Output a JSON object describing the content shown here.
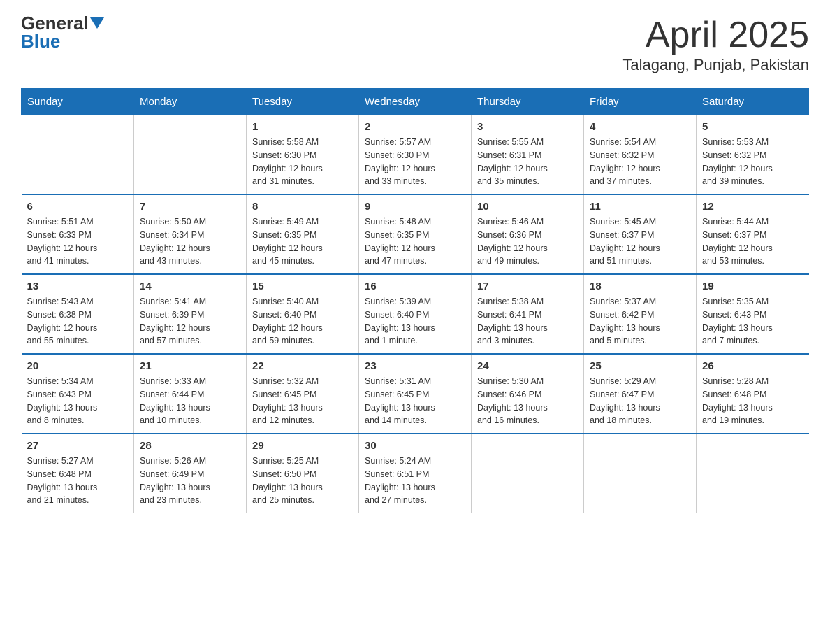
{
  "header": {
    "logo_general": "General",
    "logo_blue": "Blue",
    "title": "April 2025",
    "subtitle": "Talagang, Punjab, Pakistan"
  },
  "days_of_week": [
    "Sunday",
    "Monday",
    "Tuesday",
    "Wednesday",
    "Thursday",
    "Friday",
    "Saturday"
  ],
  "weeks": [
    [
      {
        "day": "",
        "info": ""
      },
      {
        "day": "",
        "info": ""
      },
      {
        "day": "1",
        "info": "Sunrise: 5:58 AM\nSunset: 6:30 PM\nDaylight: 12 hours\nand 31 minutes."
      },
      {
        "day": "2",
        "info": "Sunrise: 5:57 AM\nSunset: 6:30 PM\nDaylight: 12 hours\nand 33 minutes."
      },
      {
        "day": "3",
        "info": "Sunrise: 5:55 AM\nSunset: 6:31 PM\nDaylight: 12 hours\nand 35 minutes."
      },
      {
        "day": "4",
        "info": "Sunrise: 5:54 AM\nSunset: 6:32 PM\nDaylight: 12 hours\nand 37 minutes."
      },
      {
        "day": "5",
        "info": "Sunrise: 5:53 AM\nSunset: 6:32 PM\nDaylight: 12 hours\nand 39 minutes."
      }
    ],
    [
      {
        "day": "6",
        "info": "Sunrise: 5:51 AM\nSunset: 6:33 PM\nDaylight: 12 hours\nand 41 minutes."
      },
      {
        "day": "7",
        "info": "Sunrise: 5:50 AM\nSunset: 6:34 PM\nDaylight: 12 hours\nand 43 minutes."
      },
      {
        "day": "8",
        "info": "Sunrise: 5:49 AM\nSunset: 6:35 PM\nDaylight: 12 hours\nand 45 minutes."
      },
      {
        "day": "9",
        "info": "Sunrise: 5:48 AM\nSunset: 6:35 PM\nDaylight: 12 hours\nand 47 minutes."
      },
      {
        "day": "10",
        "info": "Sunrise: 5:46 AM\nSunset: 6:36 PM\nDaylight: 12 hours\nand 49 minutes."
      },
      {
        "day": "11",
        "info": "Sunrise: 5:45 AM\nSunset: 6:37 PM\nDaylight: 12 hours\nand 51 minutes."
      },
      {
        "day": "12",
        "info": "Sunrise: 5:44 AM\nSunset: 6:37 PM\nDaylight: 12 hours\nand 53 minutes."
      }
    ],
    [
      {
        "day": "13",
        "info": "Sunrise: 5:43 AM\nSunset: 6:38 PM\nDaylight: 12 hours\nand 55 minutes."
      },
      {
        "day": "14",
        "info": "Sunrise: 5:41 AM\nSunset: 6:39 PM\nDaylight: 12 hours\nand 57 minutes."
      },
      {
        "day": "15",
        "info": "Sunrise: 5:40 AM\nSunset: 6:40 PM\nDaylight: 12 hours\nand 59 minutes."
      },
      {
        "day": "16",
        "info": "Sunrise: 5:39 AM\nSunset: 6:40 PM\nDaylight: 13 hours\nand 1 minute."
      },
      {
        "day": "17",
        "info": "Sunrise: 5:38 AM\nSunset: 6:41 PM\nDaylight: 13 hours\nand 3 minutes."
      },
      {
        "day": "18",
        "info": "Sunrise: 5:37 AM\nSunset: 6:42 PM\nDaylight: 13 hours\nand 5 minutes."
      },
      {
        "day": "19",
        "info": "Sunrise: 5:35 AM\nSunset: 6:43 PM\nDaylight: 13 hours\nand 7 minutes."
      }
    ],
    [
      {
        "day": "20",
        "info": "Sunrise: 5:34 AM\nSunset: 6:43 PM\nDaylight: 13 hours\nand 8 minutes."
      },
      {
        "day": "21",
        "info": "Sunrise: 5:33 AM\nSunset: 6:44 PM\nDaylight: 13 hours\nand 10 minutes."
      },
      {
        "day": "22",
        "info": "Sunrise: 5:32 AM\nSunset: 6:45 PM\nDaylight: 13 hours\nand 12 minutes."
      },
      {
        "day": "23",
        "info": "Sunrise: 5:31 AM\nSunset: 6:45 PM\nDaylight: 13 hours\nand 14 minutes."
      },
      {
        "day": "24",
        "info": "Sunrise: 5:30 AM\nSunset: 6:46 PM\nDaylight: 13 hours\nand 16 minutes."
      },
      {
        "day": "25",
        "info": "Sunrise: 5:29 AM\nSunset: 6:47 PM\nDaylight: 13 hours\nand 18 minutes."
      },
      {
        "day": "26",
        "info": "Sunrise: 5:28 AM\nSunset: 6:48 PM\nDaylight: 13 hours\nand 19 minutes."
      }
    ],
    [
      {
        "day": "27",
        "info": "Sunrise: 5:27 AM\nSunset: 6:48 PM\nDaylight: 13 hours\nand 21 minutes."
      },
      {
        "day": "28",
        "info": "Sunrise: 5:26 AM\nSunset: 6:49 PM\nDaylight: 13 hours\nand 23 minutes."
      },
      {
        "day": "29",
        "info": "Sunrise: 5:25 AM\nSunset: 6:50 PM\nDaylight: 13 hours\nand 25 minutes."
      },
      {
        "day": "30",
        "info": "Sunrise: 5:24 AM\nSunset: 6:51 PM\nDaylight: 13 hours\nand 27 minutes."
      },
      {
        "day": "",
        "info": ""
      },
      {
        "day": "",
        "info": ""
      },
      {
        "day": "",
        "info": ""
      }
    ]
  ]
}
